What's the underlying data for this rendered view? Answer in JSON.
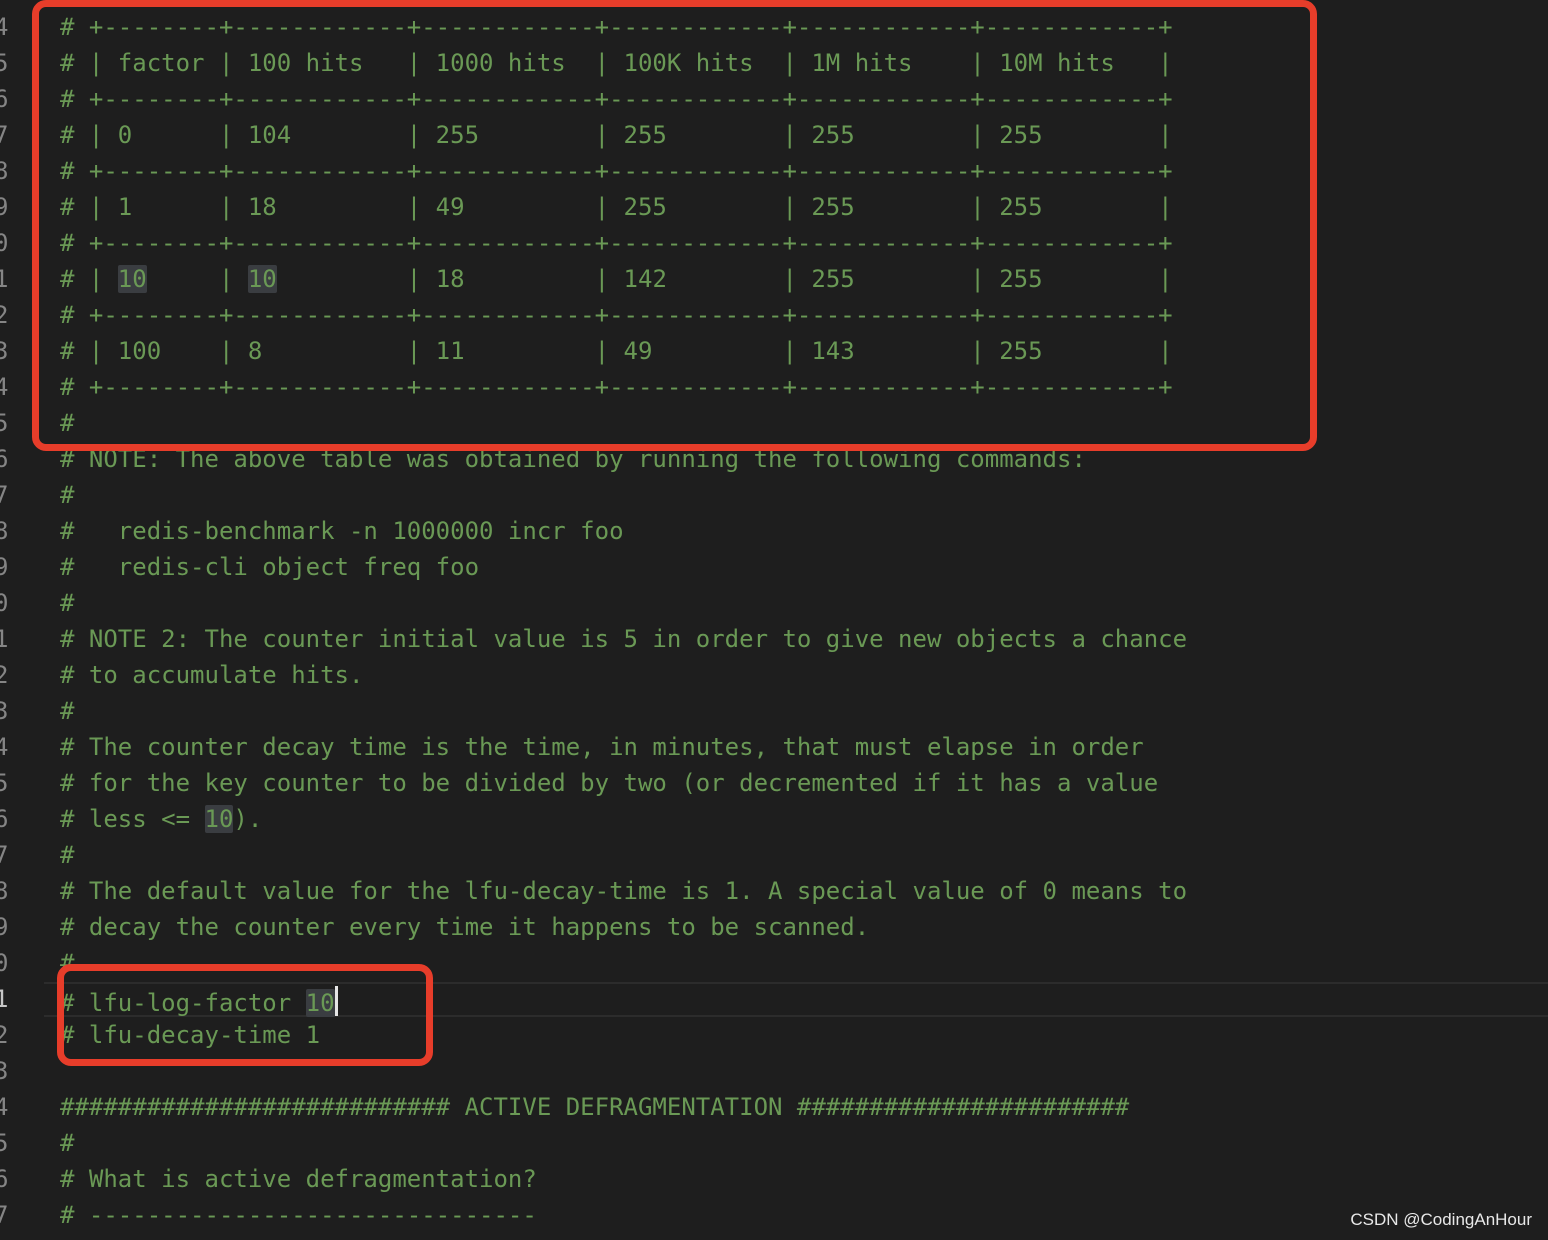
{
  "editor": {
    "lines": [
      {
        "number": "4",
        "segments": [
          {
            "text": "# +--------+------------+------------+------------+------------+------------+",
            "hl": false
          }
        ]
      },
      {
        "number": "5",
        "segments": [
          {
            "text": "# | factor | 100 hits   | 1000 hits  | 100K hits  | 1M hits    | 10M hits   |",
            "hl": false
          }
        ]
      },
      {
        "number": "6",
        "segments": [
          {
            "text": "# +--------+------------+------------+------------+------------+------------+",
            "hl": false
          }
        ]
      },
      {
        "number": "7",
        "segments": [
          {
            "text": "# | 0      | 104        | 255        | 255        | 255        | 255        |",
            "hl": false
          }
        ]
      },
      {
        "number": "8",
        "segments": [
          {
            "text": "# +--------+------------+------------+------------+------------+------------+",
            "hl": false
          }
        ]
      },
      {
        "number": "9",
        "segments": [
          {
            "text": "# | 1      | 18         | 49         | 255        | 255        | 255        |",
            "hl": false
          }
        ]
      },
      {
        "number": "0",
        "segments": [
          {
            "text": "# +--------+------------+------------+------------+------------+------------+",
            "hl": false
          }
        ]
      },
      {
        "number": "1",
        "segments": [
          {
            "text": "# | ",
            "hl": false
          },
          {
            "text": "10",
            "hl": true
          },
          {
            "text": "     | ",
            "hl": false
          },
          {
            "text": "10",
            "hl": true
          },
          {
            "text": "         | 18         | 142        | 255        | 255        |",
            "hl": false
          }
        ]
      },
      {
        "number": "2",
        "segments": [
          {
            "text": "# +--------+------------+------------+------------+------------+------------+",
            "hl": false
          }
        ]
      },
      {
        "number": "3",
        "segments": [
          {
            "text": "# | 100    | 8          | 11         | 49         | 143        | 255        |",
            "hl": false
          }
        ]
      },
      {
        "number": "4",
        "segments": [
          {
            "text": "# +--------+------------+------------+------------+------------+------------+",
            "hl": false
          }
        ]
      },
      {
        "number": "5",
        "segments": [
          {
            "text": "#",
            "hl": false
          }
        ]
      },
      {
        "number": "6",
        "segments": [
          {
            "text": "# NOTE: The above table was obtained by running the following commands:",
            "hl": false
          }
        ]
      },
      {
        "number": "7",
        "segments": [
          {
            "text": "#",
            "hl": false
          }
        ]
      },
      {
        "number": "8",
        "segments": [
          {
            "text": "#   redis-benchmark -n 1000000 incr foo",
            "hl": false
          }
        ]
      },
      {
        "number": "9",
        "segments": [
          {
            "text": "#   redis-cli object freq foo",
            "hl": false
          }
        ]
      },
      {
        "number": "0",
        "segments": [
          {
            "text": "#",
            "hl": false
          }
        ]
      },
      {
        "number": "1",
        "segments": [
          {
            "text": "# NOTE 2: The counter initial value is 5 in order to give new objects a chance",
            "hl": false
          }
        ]
      },
      {
        "number": "2",
        "segments": [
          {
            "text": "# to accumulate hits.",
            "hl": false
          }
        ]
      },
      {
        "number": "3",
        "segments": [
          {
            "text": "#",
            "hl": false
          }
        ]
      },
      {
        "number": "4",
        "segments": [
          {
            "text": "# The counter decay time is the time, in minutes, that must elapse in order",
            "hl": false
          }
        ]
      },
      {
        "number": "5",
        "segments": [
          {
            "text": "# for the key counter to be divided by two (or decremented if it has a value",
            "hl": false
          }
        ]
      },
      {
        "number": "6",
        "segments": [
          {
            "text": "# less <= ",
            "hl": false
          },
          {
            "text": "10",
            "hl": true
          },
          {
            "text": ").",
            "hl": false
          }
        ]
      },
      {
        "number": "7",
        "segments": [
          {
            "text": "#",
            "hl": false
          }
        ]
      },
      {
        "number": "8",
        "segments": [
          {
            "text": "# The default value for the lfu-decay-time is 1. A special value of 0 means to",
            "hl": false
          }
        ]
      },
      {
        "number": "9",
        "segments": [
          {
            "text": "# decay the counter every time it happens to be scanned.",
            "hl": false
          }
        ]
      },
      {
        "number": "0",
        "segments": [
          {
            "text": "#",
            "hl": false
          }
        ]
      },
      {
        "number": "1",
        "current": true,
        "segments": [
          {
            "text": "# lfu-log-factor ",
            "hl": false
          },
          {
            "text": "10",
            "hl": true
          }
        ]
      },
      {
        "number": "2",
        "segments": [
          {
            "text": "# lfu-decay-time 1",
            "hl": false
          }
        ]
      },
      {
        "number": "3",
        "segments": [
          {
            "text": "",
            "hl": false
          }
        ]
      },
      {
        "number": "4",
        "segments": [
          {
            "text": "########################### ACTIVE DEFRAGMENTATION #######################",
            "hl": false
          }
        ]
      },
      {
        "number": "5",
        "segments": [
          {
            "text": "#",
            "hl": false
          }
        ]
      },
      {
        "number": "6",
        "segments": [
          {
            "text": "# What is active defragmentation?",
            "hl": false
          }
        ]
      },
      {
        "number": "7",
        "segments": [
          {
            "text": "# -------------------------------",
            "hl": false
          }
        ]
      }
    ]
  },
  "colors": {
    "background": "#1e1e1e",
    "comment": "#6a9955",
    "line_number": "#858585",
    "highlight": "#3a3d41",
    "annotation": "#e73d2a"
  },
  "watermark": "CSDN @CodingAnHour"
}
